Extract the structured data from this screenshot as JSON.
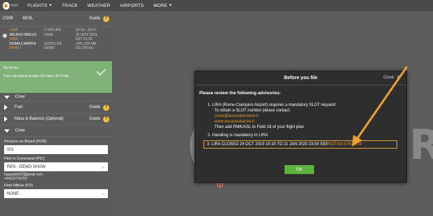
{
  "nav": {
    "logo_text": "skyd",
    "items": [
      {
        "label": "FLIGHTS",
        "caret": true
      },
      {
        "label": "TRACK",
        "caret": false
      },
      {
        "label": "WEATHER",
        "caret": false
      },
      {
        "label": "AIRPORTS",
        "caret": false
      },
      {
        "label": "MORE",
        "caret": true
      }
    ]
  },
  "left": {
    "header": {
      "aircraft": "C50B",
      "reg": "BESL",
      "guide": "Guide",
      "help": "?"
    },
    "flight": {
      "col1": [
        "LIRA",
        "MILANO BRESS",
        "LIRA",
        "ROMA CIAMPIN",
        "DRAFT"
      ],
      "col2": [
        "2 VFR-IFR",
        "C50B",
        "10100 LBS",
        "DEMO"
      ],
      "col3": [
        "22:15 - 23:47",
        "25 NOV 2019",
        "EET 01:32",
        "+0% 293 NM",
        "GS 185 kts"
      ]
    },
    "status": {
      "title": "No Errors",
      "detail": "Fuel calculated at take off mass: 8174 lbs"
    },
    "sections": [
      {
        "label": "Crew",
        "expanded": true,
        "guide": false
      },
      {
        "label": "Fuel",
        "expanded": false,
        "guide": true
      },
      {
        "label": "Mass & Balance (Optional)",
        "expanded": false,
        "guide": true
      },
      {
        "label": "Crew",
        "expanded": true,
        "guide": false
      }
    ],
    "guide_label": "Guide",
    "help": "?",
    "pob": {
      "label": "Persons on Board (POB)",
      "value": "001"
    },
    "pic": {
      "label": "Pilot in Command (PIC)",
      "value": "REN - DEMO SHOW",
      "email": "happypilot22@gmail.com",
      "phone": "+44123716752"
    },
    "fo": {
      "label": "First Officer (FO)",
      "value": "NONE"
    }
  },
  "modal": {
    "title": "Before you file",
    "close_label": "Close",
    "close_icon": "×",
    "intro": "Please review the following advisories:",
    "advisory1": {
      "line1": "1.  LIRA (Rome-Ciampino Airport) requires a mandatory SLOT request!",
      "line2": "To obtain a SLOT number please contact:",
      "email": "score@assoclearance.it",
      "web": "www.assoclearance.it",
      "line5": "Then add RMK/ASL to Field 18 of your flight plan"
    },
    "advisory2": "2.  Handling is mandatory in LIRA",
    "advisory3": {
      "text": "3.  LIRA CLOSED 24 OCT 2019 10:19 TO 21 JAN 2020 23:00 SEE ",
      "notam": "NOTAM A7610/19"
    },
    "ok_label": "OK"
  },
  "map": {
    "bracket": "(",
    "text": "cR"
  },
  "colors": {
    "accent": "#e89a2d",
    "ok_button": "#5db33b",
    "status_green": "#7fb178"
  }
}
